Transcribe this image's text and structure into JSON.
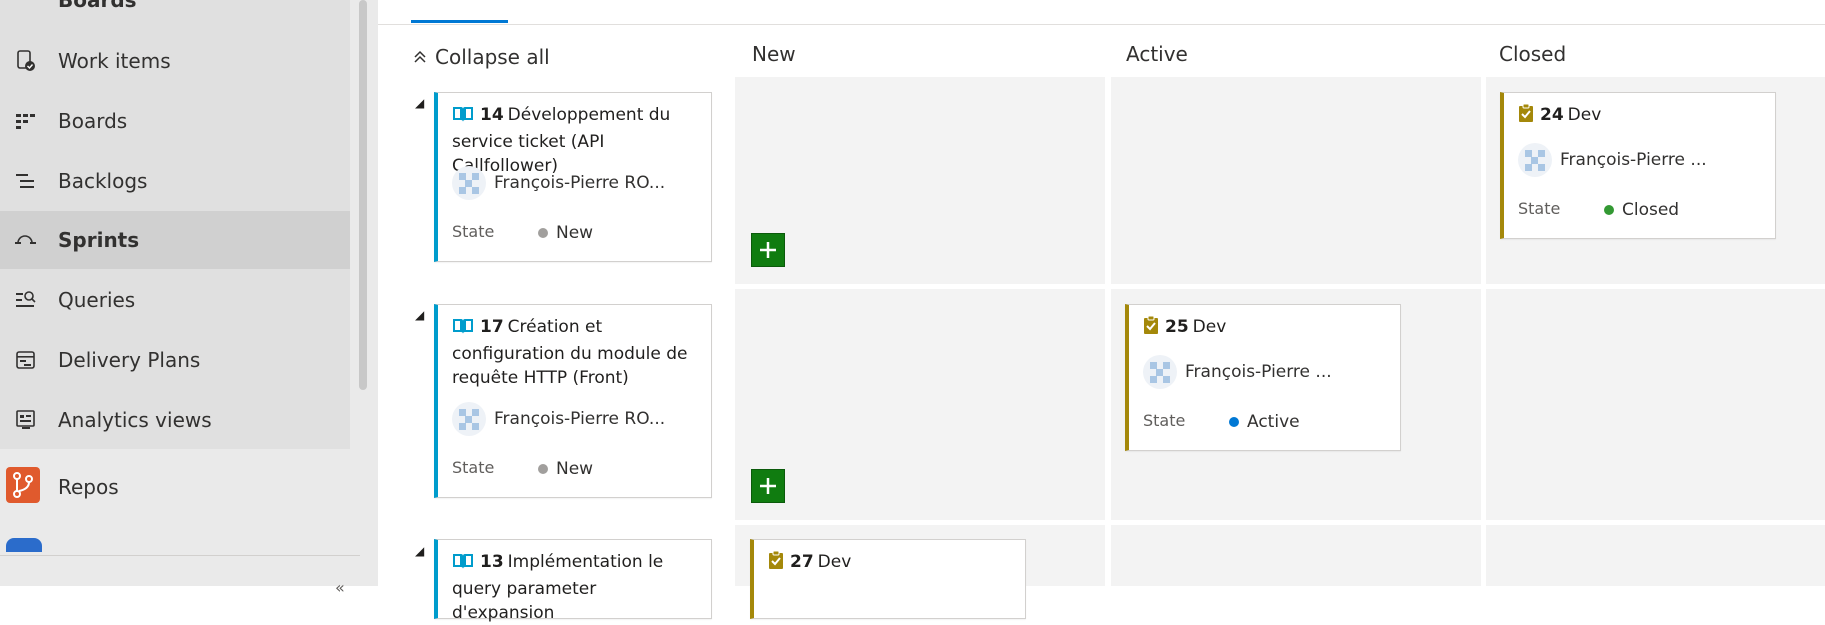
{
  "sidebar": {
    "top_label": "Boards",
    "items": [
      {
        "label": "Work items",
        "icon": "work-items-icon"
      },
      {
        "label": "Boards",
        "icon": "boards-icon"
      },
      {
        "label": "Backlogs",
        "icon": "backlogs-icon"
      },
      {
        "label": "Sprints",
        "icon": "sprints-icon"
      },
      {
        "label": "Queries",
        "icon": "queries-icon"
      },
      {
        "label": "Delivery Plans",
        "icon": "delivery-plans-icon"
      },
      {
        "label": "Analytics views",
        "icon": "analytics-views-icon"
      }
    ],
    "repos_label": "Repos",
    "collapse_chevron": "«"
  },
  "board": {
    "collapse_all": "Collapse all",
    "columns": [
      "New",
      "Active",
      "Closed"
    ],
    "state_label": "State",
    "colors": {
      "new": "#a19f9d",
      "active": "#0078d4",
      "closed": "#339933",
      "story": "#009ccc",
      "task": "#a4880a",
      "add": "#107c10"
    },
    "rows": [
      {
        "story": {
          "id": "14",
          "title": "Développement du service ticket (API Callfollower)",
          "assignee": "François-Pierre RO...",
          "state": "New"
        },
        "tasks": [
          {
            "column": "Closed",
            "id": "24",
            "title": "Dev",
            "assignee": "François-Pierre ...",
            "state": "Closed"
          }
        ]
      },
      {
        "story": {
          "id": "17",
          "title": "Création et configuration du module de requête HTTP (Front)",
          "assignee": "François-Pierre RO...",
          "state": "New"
        },
        "tasks": [
          {
            "column": "Active",
            "id": "25",
            "title": "Dev",
            "assignee": "François-Pierre ...",
            "state": "Active"
          }
        ]
      },
      {
        "story": {
          "id": "13",
          "title": "Implémentation le query parameter d'expansion"
        },
        "tasks": [
          {
            "column": "New",
            "id": "27",
            "title": "Dev"
          }
        ]
      }
    ]
  }
}
